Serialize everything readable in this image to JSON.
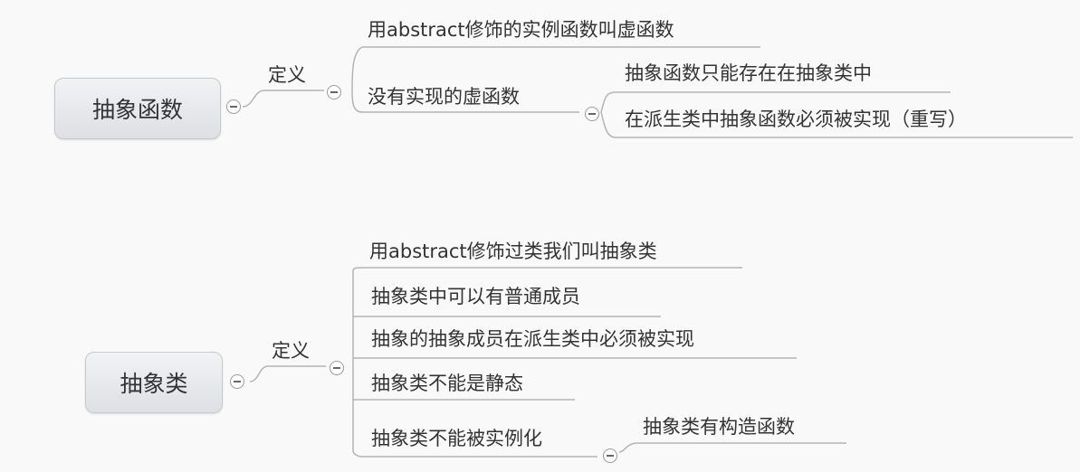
{
  "map1": {
    "root": "抽象函数",
    "branch": "定义",
    "items": [
      "用abstract修饰的实例函数叫虚函数",
      "没有实现的虚函数"
    ],
    "subitems": [
      "抽象函数只能存在在抽象类中",
      "在派生类中抽象函数必须被实现（重写）"
    ]
  },
  "map2": {
    "root": "抽象类",
    "branch": "定义",
    "items": [
      "用abstract修饰过类我们叫抽象类",
      "抽象类中可以有普通成员",
      "抽象的抽象成员在派生类中必须被实现",
      "抽象类不能是静态",
      "抽象类不能被实例化"
    ],
    "subitems": [
      "抽象类有构造函数"
    ]
  }
}
